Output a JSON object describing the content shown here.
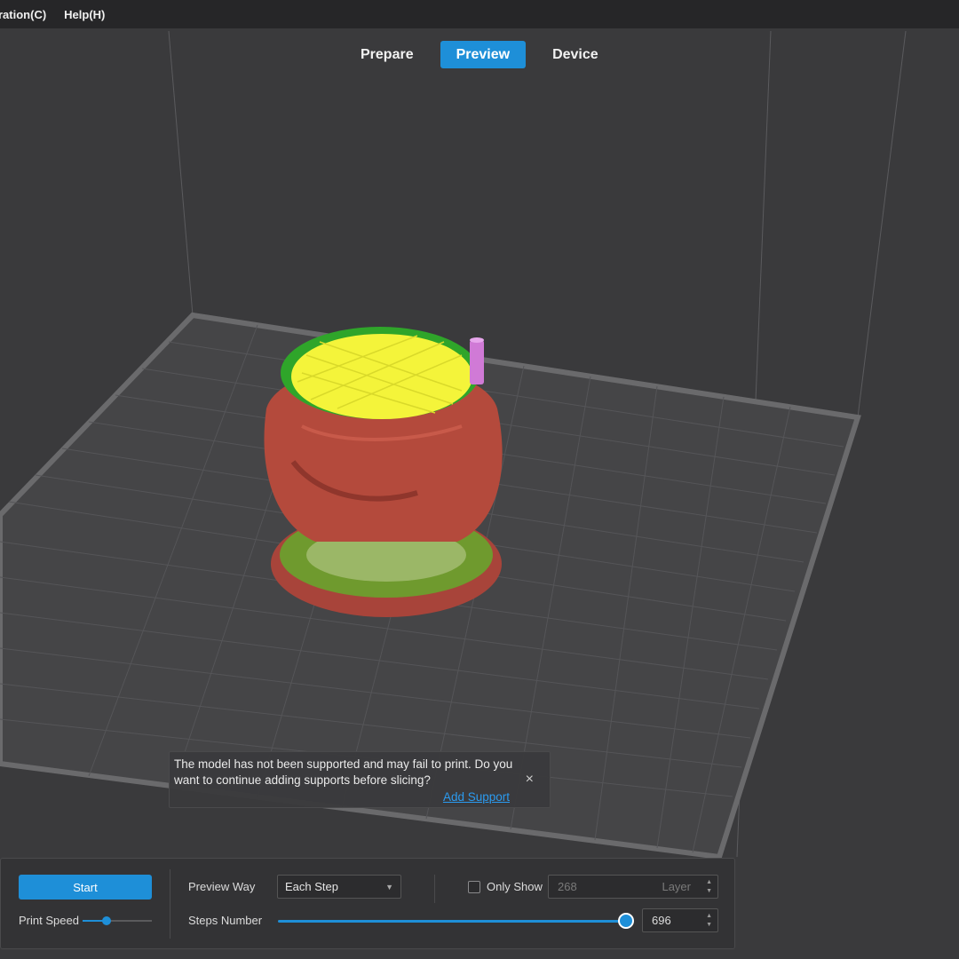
{
  "menu": [
    "ration(C)",
    "Help(H)"
  ],
  "tabs": [
    {
      "label": "Prepare",
      "active": false
    },
    {
      "label": "Preview",
      "active": true
    },
    {
      "label": "Device",
      "active": false
    }
  ],
  "notification": {
    "message": "The model has not been supported and may fail to print. Do you want to continue adding supports before slicing?",
    "action_label": "Add Support",
    "close_icon": "×"
  },
  "panel": {
    "start_label": "Start",
    "print_speed_label": "Print Speed",
    "print_speed_level": 0.35,
    "preview_way_label": "Preview Way",
    "preview_way_value": "Each Step",
    "only_show_label": "Only Show",
    "only_show_checked": false,
    "layer_value": "268",
    "layer_suffix": "Layer",
    "steps_label": "Steps Number",
    "steps_value": "696",
    "steps_progress": 1.0
  },
  "colors": {
    "accent": "#1e8fd8",
    "model_wall": "#b44a3c",
    "model_top_infill": "#f4f43a",
    "model_infill": "#3fae2a",
    "nozzle": "#d07ad6"
  }
}
